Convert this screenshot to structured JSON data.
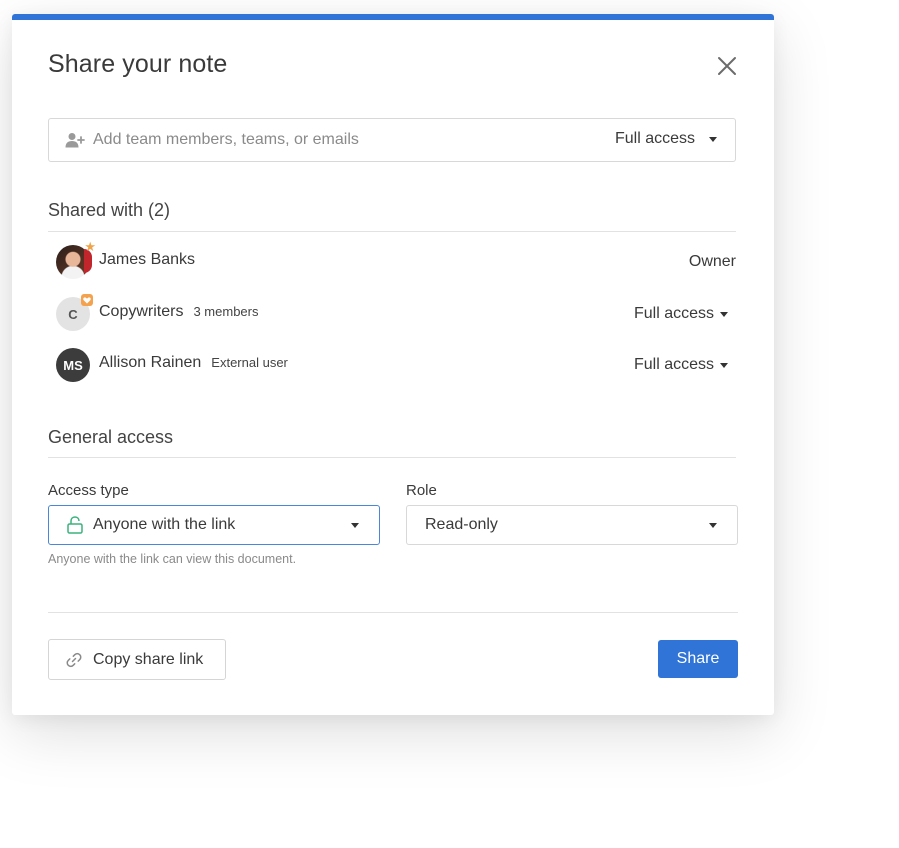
{
  "colors": {
    "accent": "#2f74d6",
    "focus_border": "#4a86d9",
    "lock_green": "#3bb27d",
    "copywriters_badge": "#f4a24d",
    "owner_star": "#f0a44a",
    "dark_avatar": "#3c3c3c",
    "light_avatar": "#e3e3e3"
  },
  "modal": {
    "title": "Share your note",
    "close_icon": "close-icon"
  },
  "invite": {
    "placeholder": "Add team members, teams, or emails",
    "value": "",
    "icon": "add-person-icon",
    "role_label": "Full access"
  },
  "shared_with": {
    "title": "Shared with (2)",
    "members": [
      {
        "name": "James Banks",
        "meta": "",
        "role": "Owner",
        "avatar_type": "photo",
        "badge_icon": "star-icon",
        "badge_glyph": "★"
      },
      {
        "name": "Copywriters",
        "meta": "3 members",
        "role": "Full access",
        "avatar_type": "letter",
        "avatar_text": "C",
        "badge_icon": "heart-badge-icon"
      },
      {
        "name": "Allison Rainen",
        "meta": "External user",
        "role": "Full access",
        "avatar_type": "letter",
        "avatar_text": "MS"
      }
    ]
  },
  "general_access": {
    "title": "General access",
    "access_type_label": "Access type",
    "access_type_value": "Anyone with the link",
    "access_type_icon": "unlock-icon",
    "role_label": "Role",
    "role_value": "Read-only",
    "help_text": "Anyone with the link can view this document."
  },
  "footer": {
    "copy_link_label": "Copy share link",
    "copy_link_icon": "link-icon",
    "share_label": "Share"
  }
}
